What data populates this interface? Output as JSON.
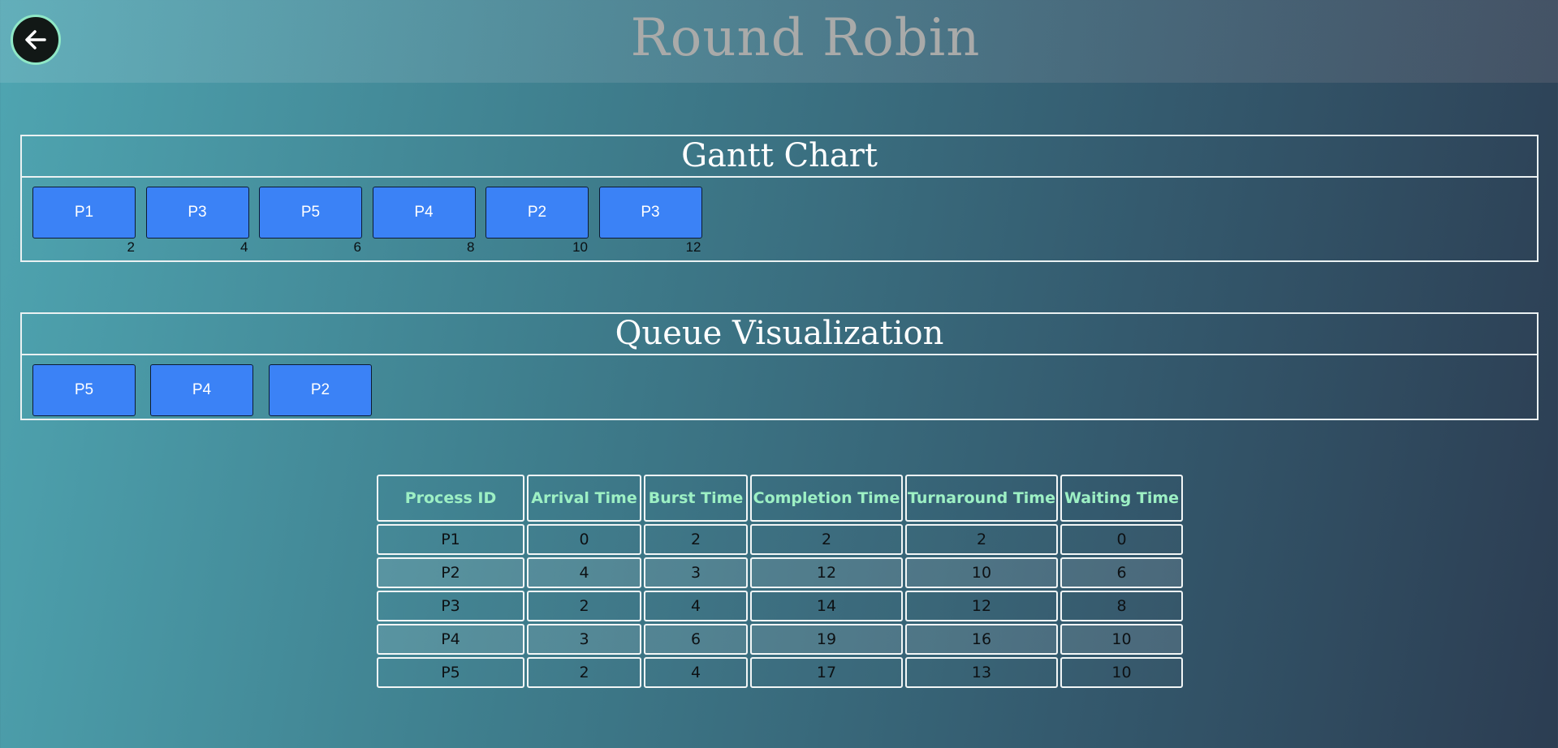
{
  "header": {
    "title": "Round Robin",
    "back_icon": "arrow-left-icon"
  },
  "gantt": {
    "title": "Gantt Chart",
    "blocks": [
      {
        "label": "P1",
        "end": "2"
      },
      {
        "label": "P3",
        "end": "4"
      },
      {
        "label": "P5",
        "end": "6"
      },
      {
        "label": "P4",
        "end": "8"
      },
      {
        "label": "P2",
        "end": "10"
      },
      {
        "label": "P3",
        "end": "12"
      }
    ]
  },
  "queue": {
    "title": "Queue Visualization",
    "items": [
      "P5",
      "P4",
      "P2"
    ]
  },
  "table": {
    "headers": [
      "Process ID",
      "Arrival Time",
      "Burst Time",
      "Completion Time",
      "Turnaround Time",
      "Waiting Time"
    ],
    "rows": [
      [
        "P1",
        "0",
        "2",
        "2",
        "2",
        "0"
      ],
      [
        "P2",
        "4",
        "3",
        "12",
        "10",
        "6"
      ],
      [
        "P3",
        "2",
        "4",
        "14",
        "12",
        "8"
      ],
      [
        "P4",
        "3",
        "6",
        "19",
        "16",
        "10"
      ],
      [
        "P5",
        "2",
        "4",
        "17",
        "13",
        "10"
      ]
    ]
  },
  "colors": {
    "block": "#3b82f6",
    "header_text": "#9df0c4",
    "title_text": "#a9aaa9"
  }
}
